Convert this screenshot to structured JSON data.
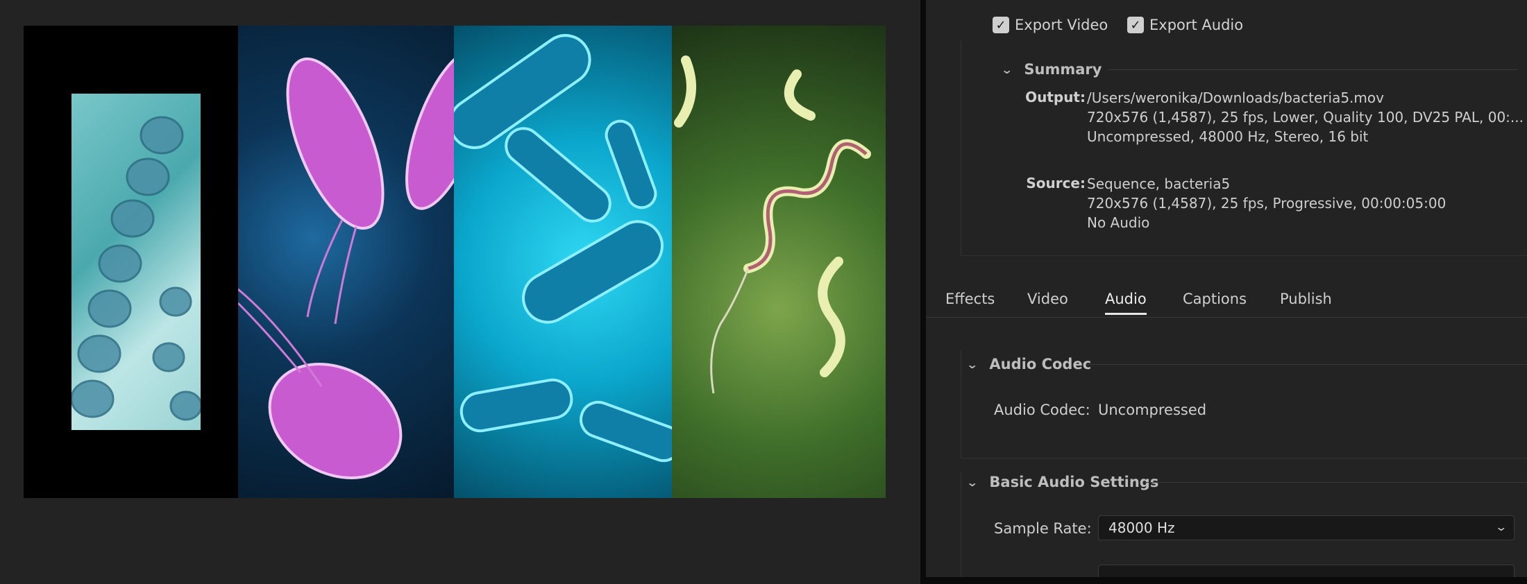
{
  "export": {
    "video_label": "Export Video",
    "audio_label": "Export Audio"
  },
  "summary": {
    "title": "Summary",
    "output_label": "Output:",
    "output_lines": [
      "/Users/weronika/Downloads/bacteria5.mov",
      "720x576 (1,4587), 25 fps, Lower, Quality 100, DV25 PAL, 00:...",
      "Uncompressed, 48000 Hz, Stereo, 16 bit"
    ],
    "source_label": "Source:",
    "source_lines": [
      "Sequence, bacteria5",
      "720x576 (1,4587), 25 fps, Progressive, 00:00:05:00",
      "No Audio"
    ]
  },
  "tabs": [
    "Effects",
    "Video",
    "Audio",
    "Captions",
    "Publish"
  ],
  "active_tab": "Audio",
  "audio_codec": {
    "section_title": "Audio Codec",
    "label": "Audio Codec:",
    "value": "Uncompressed"
  },
  "basic_audio": {
    "section_title": "Basic Audio Settings",
    "sample_rate_label": "Sample Rate:",
    "sample_rate_value": "48000 Hz"
  },
  "colors": {
    "background": "#232323",
    "accent": "#e8e8e8"
  }
}
